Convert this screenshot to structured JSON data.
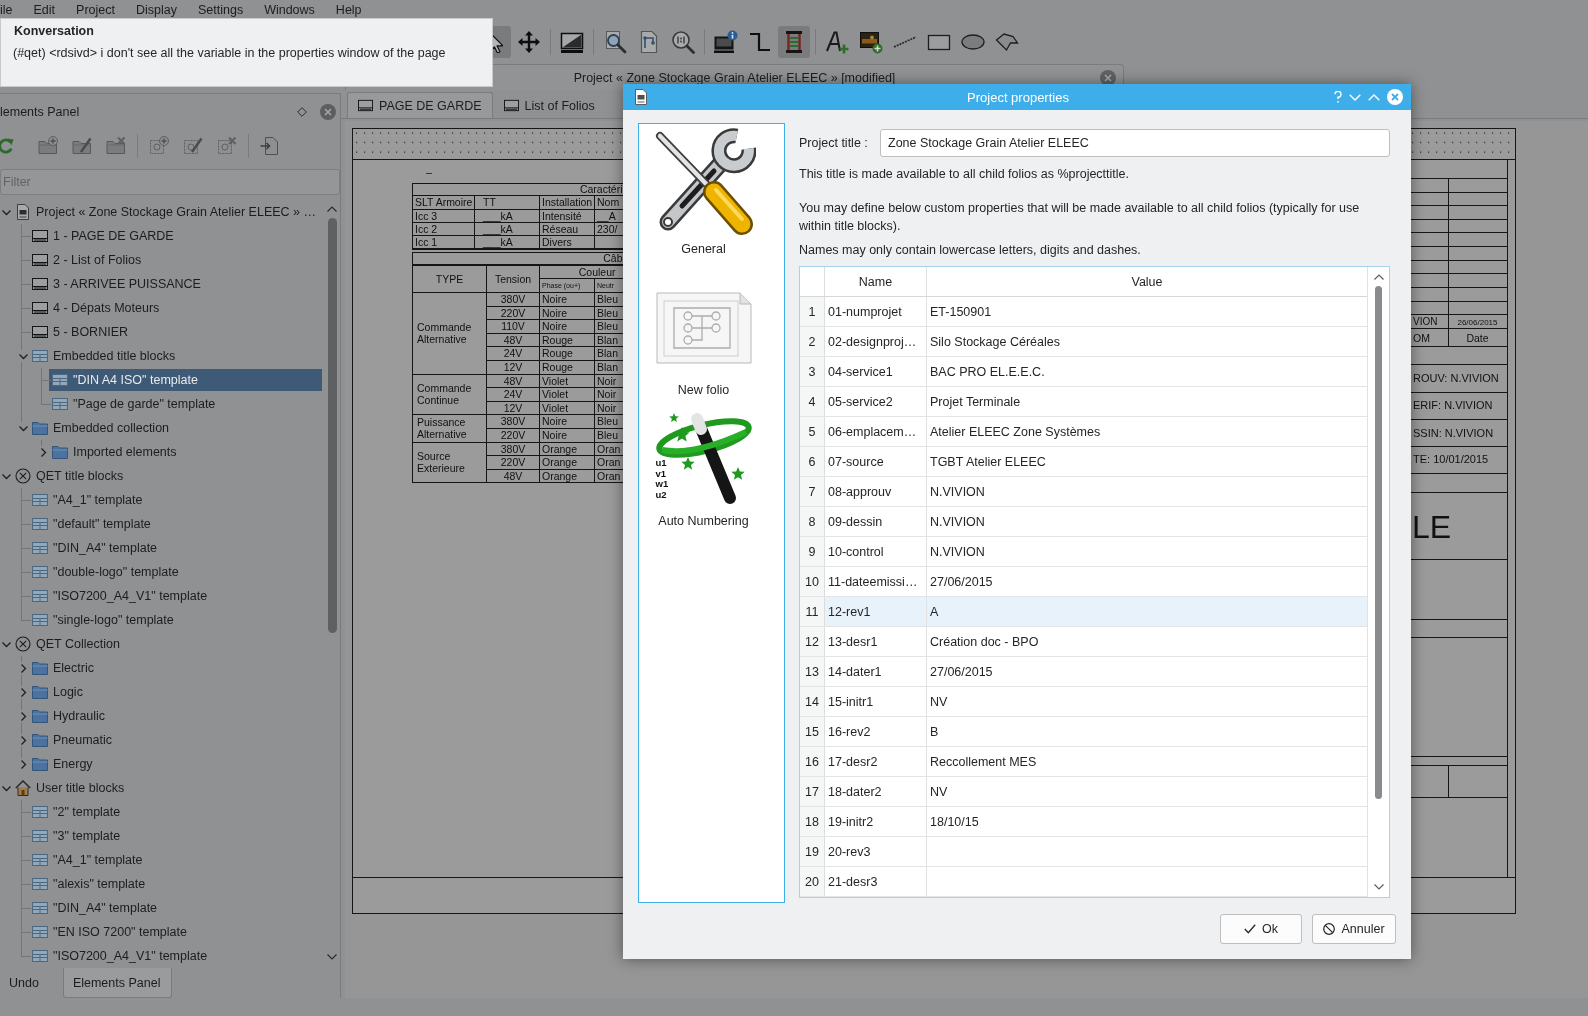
{
  "menu": [
    "ile",
    "Edit",
    "Project",
    "Display",
    "Settings",
    "Windows",
    "Help"
  ],
  "tooltip": {
    "title": "Konversation",
    "text": "(#qet) <rdsivd> i don't see all the variable in the properties window of the page"
  },
  "toolbar": [
    {
      "kind": "select",
      "active": true
    },
    {
      "kind": "move",
      "active": false
    },
    {
      "kind": "separator"
    },
    {
      "kind": "screen",
      "active": false
    },
    {
      "kind": "separator"
    },
    {
      "kind": "zoom-in",
      "active": false
    },
    {
      "kind": "zoom-fit",
      "active": false
    },
    {
      "kind": "zoom-reset",
      "active": false
    },
    {
      "kind": "separator"
    },
    {
      "kind": "properties",
      "active": false
    },
    {
      "kind": "conductor",
      "active": false
    },
    {
      "kind": "terminal",
      "active": true
    },
    {
      "kind": "separator"
    },
    {
      "kind": "text",
      "active": false
    },
    {
      "kind": "image",
      "active": false
    },
    {
      "kind": "line",
      "active": false
    },
    {
      "kind": "rectangle",
      "active": false
    },
    {
      "kind": "ellipse",
      "active": false
    },
    {
      "kind": "polygon",
      "active": false
    }
  ],
  "document_window": {
    "title": "Project « Zone Stockage Grain Atelier ELEEC » [modified]",
    "tabs": [
      {
        "label": "PAGE DE GARDE",
        "selected": true
      },
      {
        "label": "List of Folios",
        "selected": false
      }
    ]
  },
  "folio": {
    "mark": "–",
    "spec_title": "Caractéri",
    "spec_rows": [
      [
        "SLT Armoire",
        "TT",
        "Installation",
        "Nom"
      ],
      [
        "Icc 3",
        "___kA",
        "Intensité",
        "__A"
      ],
      [
        "Icc 2",
        "___kA",
        "Réseau",
        "230/"
      ],
      [
        "Icc 1",
        "___kA",
        "Divers"
      ]
    ],
    "cable_title": "Câb",
    "cable_headers": [
      "TYPE",
      "Tension",
      "Couleur"
    ],
    "color_headers": [
      "Phase (ou+)",
      "Neutr"
    ],
    "cable_groups": [
      {
        "type": "Commande Alternative",
        "rows": [
          [
            "380V",
            "Noire",
            "Bleu"
          ],
          [
            "220V",
            "Noire",
            "Bleu"
          ],
          [
            "110V",
            "Noire",
            "Bleu"
          ],
          [
            "48V",
            "Rouge",
            "Blan"
          ],
          [
            "24V",
            "Rouge",
            "Blan"
          ],
          [
            "12V",
            "Rouge",
            "Blan"
          ]
        ]
      },
      {
        "type": "Commande Continue",
        "rows": [
          [
            "48V",
            "Violet",
            "Noir"
          ],
          [
            "24V",
            "Violet",
            "Noir"
          ],
          [
            "12V",
            "Violet",
            "Noir"
          ]
        ]
      },
      {
        "type": "Puissance Alternative",
        "rows": [
          [
            "380V",
            "Noire",
            "Bleu"
          ],
          [
            "220V",
            "Noire",
            "Bleu"
          ]
        ]
      },
      {
        "type": "Source Exterieure",
        "rows": [
          [
            "380V",
            "Orange",
            "Oran"
          ],
          [
            "220V",
            "Orange",
            "Oran"
          ],
          [
            "48V",
            "Orange",
            "Oran"
          ]
        ]
      }
    ],
    "title_block": {
      "rows": [
        [
          "VION",
          "26/06/2015"
        ],
        [
          "OM",
          "Date"
        ]
      ],
      "signatures": [
        "ROUV: N.VIVION",
        "ERIF: N.VIVION",
        "SSIN: N.VIVION",
        "TE: 10/01/2015"
      ],
      "title": "LE"
    }
  },
  "dock": {
    "title": "lements Panel",
    "filter_placeholder": "Filter",
    "tree": [
      {
        "label": "Project « Zone Stockage Grain Atelier ELEEC » …",
        "kind": "project",
        "expanded": true,
        "selected": false,
        "children": [
          {
            "label": "1 - PAGE DE GARDE",
            "kind": "folio",
            "selected": false
          },
          {
            "label": "2 - List of Folios",
            "kind": "folio",
            "selected": false
          },
          {
            "label": "3 - ARRIVEE PUISSANCE",
            "kind": "folio",
            "selected": false
          },
          {
            "label": "4 - Dépats Moteurs",
            "kind": "folio",
            "selected": false
          },
          {
            "label": "5 - BORNIER",
            "kind": "folio",
            "selected": false
          },
          {
            "label": "Embedded title blocks",
            "kind": "titleblocks",
            "expanded": true,
            "selected": false,
            "children": [
              {
                "label": "\"DIN A4 ISO\" template",
                "kind": "template",
                "selected": true
              },
              {
                "label": "\"Page de garde\" template",
                "kind": "template",
                "selected": false
              }
            ]
          },
          {
            "label": "Embedded collection",
            "kind": "folder",
            "expanded": true,
            "selected": false,
            "children": [
              {
                "label": "Imported elements",
                "kind": "folder",
                "expanded": false,
                "selected": false
              }
            ]
          }
        ]
      },
      {
        "label": "QET title blocks",
        "kind": "collection",
        "expanded": true,
        "selected": false,
        "children": [
          {
            "label": "\"A4_1\" template",
            "kind": "template",
            "selected": false
          },
          {
            "label": "\"default\" template",
            "kind": "template",
            "selected": false
          },
          {
            "label": "\"DIN_A4\" template",
            "kind": "template",
            "selected": false
          },
          {
            "label": "\"double-logo\" template",
            "kind": "template",
            "selected": false
          },
          {
            "label": "\"ISO7200_A4_V1\" template",
            "kind": "template",
            "selected": false
          },
          {
            "label": "\"single-logo\" template",
            "kind": "template",
            "selected": false
          }
        ]
      },
      {
        "label": "QET Collection",
        "kind": "collection",
        "expanded": true,
        "selected": false,
        "children": [
          {
            "label": "Electric",
            "kind": "folder",
            "expanded": false,
            "selected": false
          },
          {
            "label": "Logic",
            "kind": "folder",
            "expanded": false,
            "selected": false
          },
          {
            "label": "Hydraulic",
            "kind": "folder",
            "expanded": false,
            "selected": false
          },
          {
            "label": "Pneumatic",
            "kind": "folder",
            "expanded": false,
            "selected": false
          },
          {
            "label": "Energy",
            "kind": "folder",
            "expanded": false,
            "selected": false
          }
        ]
      },
      {
        "label": "User title blocks",
        "kind": "user",
        "expanded": true,
        "selected": false,
        "children": [
          {
            "label": "\"2\" template",
            "kind": "template",
            "selected": false
          },
          {
            "label": "\"3\" template",
            "kind": "template",
            "selected": false
          },
          {
            "label": "\"A4_1\" template",
            "kind": "template",
            "selected": false
          },
          {
            "label": "\"alexis\" template",
            "kind": "template",
            "selected": false
          },
          {
            "label": "\"DIN_A4\" template",
            "kind": "template",
            "selected": false
          },
          {
            "label": "\"EN ISO 7200\" template",
            "kind": "template",
            "selected": false
          },
          {
            "label": "\"ISO7200_A4_V1\" template",
            "kind": "template",
            "selected": false
          }
        ]
      }
    ],
    "tabs": [
      {
        "label": "Undo",
        "selected": false
      },
      {
        "label": "Elements Panel",
        "selected": true
      }
    ]
  },
  "dialog": {
    "title": "Project properties",
    "pages": [
      {
        "label": "General",
        "kind": "general"
      },
      {
        "label": "New folio",
        "kind": "new-folio"
      },
      {
        "label": "Auto Numbering",
        "kind": "numbering",
        "icon_text": [
          "u1",
          "v1",
          "w1",
          "u2"
        ]
      }
    ],
    "title_label": "Project title :",
    "project_title": "Zone Stockage Grain Atelier ELEEC",
    "info": "This title is made available to all child folios as %projecttitle.",
    "custom_info": "You may define below custom properties that will be made available to all child folios (typically for use within title blocks).",
    "names_note": "Names may only contain lowercase letters, digits and dashes.",
    "table": {
      "columns": [
        "Name",
        "Value"
      ],
      "rows": [
        {
          "number": "1",
          "name": "01-numprojet",
          "value": "ET-150901",
          "hovered": false
        },
        {
          "number": "2",
          "name": "02-designproj…",
          "value": "Silo Stockage Céréales",
          "hovered": false
        },
        {
          "number": "3",
          "name": "04-service1",
          "value": "BAC PRO EL.E.E.C.",
          "hovered": false
        },
        {
          "number": "4",
          "name": "05-service2",
          "value": "Projet Terminale",
          "hovered": false
        },
        {
          "number": "5",
          "name": "06-emplacem…",
          "value": "Atelier ELEEC Zone Systèmes",
          "hovered": false
        },
        {
          "number": "6",
          "name": "07-source",
          "value": "TGBT Atelier ELEEC",
          "hovered": false
        },
        {
          "number": "7",
          "name": "08-approuv",
          "value": "N.VIVION",
          "hovered": false
        },
        {
          "number": "8",
          "name": "09-dessin",
          "value": "N.VIVION",
          "hovered": false
        },
        {
          "number": "9",
          "name": "10-control",
          "value": "N.VIVION",
          "hovered": false
        },
        {
          "number": "10",
          "name": "11-dateemissi…",
          "value": "27/06/2015",
          "hovered": false
        },
        {
          "number": "11",
          "name": "12-rev1",
          "value": "A",
          "hovered": true
        },
        {
          "number": "12",
          "name": "13-desr1",
          "value": "Création doc - BPO",
          "hovered": false
        },
        {
          "number": "13",
          "name": "14-dater1",
          "value": "27/06/2015",
          "hovered": false
        },
        {
          "number": "14",
          "name": "15-initr1",
          "value": "NV",
          "hovered": false
        },
        {
          "number": "15",
          "name": "16-rev2",
          "value": "B",
          "hovered": false
        },
        {
          "number": "16",
          "name": "17-desr2",
          "value": "Reccollement MES",
          "hovered": false
        },
        {
          "number": "17",
          "name": "18-dater2",
          "value": "NV",
          "hovered": false
        },
        {
          "number": "18",
          "name": "19-initr2",
          "value": "18/10/15",
          "hovered": false
        },
        {
          "number": "19",
          "name": "20-rev3",
          "hovered": false
        },
        {
          "number": "20",
          "name": "21-desr3",
          "hovered": false
        }
      ]
    },
    "buttons": [
      {
        "label": "Ok",
        "kind": "ok"
      },
      {
        "label": "Annuler",
        "kind": "cancel"
      }
    ]
  }
}
